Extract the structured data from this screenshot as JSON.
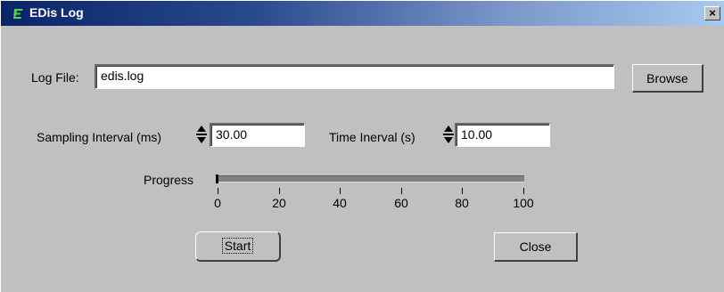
{
  "window": {
    "title": "EDis Log",
    "close_glyph": "×",
    "title_icon": "edis-app-icon"
  },
  "log_file": {
    "label": "Log File:",
    "value": "edis.log",
    "browse_label": "Browse"
  },
  "sampling": {
    "label": "Sampling Interval (ms)",
    "value": "30.00"
  },
  "time_interval": {
    "label": "Time Inerval (s)",
    "value": "10.00"
  },
  "progress": {
    "label": "Progress",
    "value_percent": 0,
    "ticks": [
      "0",
      "20",
      "40",
      "60",
      "80",
      "100"
    ]
  },
  "actions": {
    "start_label": "Start",
    "close_label": "Close"
  },
  "colors": {
    "face": "#c0c0c0",
    "title_start": "#0a246a",
    "title_end": "#a6caf0",
    "progress_fill": "#000080"
  }
}
